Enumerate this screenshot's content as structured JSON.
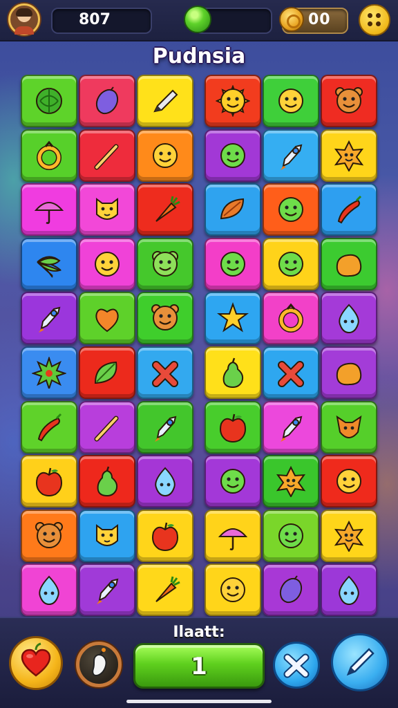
{
  "header": {
    "score": "807",
    "coins": "00"
  },
  "title": "Pudnsia",
  "footer": {
    "label": "Ilaatt:",
    "count": "1"
  },
  "board": {
    "rows": [
      [
        {
          "color": "#5ed32a",
          "icon": "melon"
        },
        {
          "color": "#ef3a5e",
          "icon": "plum"
        },
        {
          "color": "#ffe11a",
          "icon": "pencil"
        },
        {
          "color": "#f23c1e",
          "icon": "sun"
        },
        {
          "color": "#3fcf3a",
          "icon": "smiley"
        },
        {
          "color": "#ef2c22",
          "icon": "bear"
        }
      ],
      [
        {
          "color": "#57d02a",
          "icon": "ring"
        },
        {
          "color": "#ee2c3c",
          "icon": "wand"
        },
        {
          "color": "#ff8a1a",
          "icon": "smiley"
        },
        {
          "color": "#a238d6",
          "icon": "blob-face"
        },
        {
          "color": "#35aef2",
          "icon": "rocket"
        },
        {
          "color": "#ffd51a",
          "icon": "star-face"
        }
      ],
      [
        {
          "color": "#f03ce0",
          "icon": "umbrella"
        },
        {
          "color": "#f248d8",
          "icon": "cat-face"
        },
        {
          "color": "#ee2c1e",
          "icon": "carrot"
        },
        {
          "color": "#2fa3ef",
          "icon": "leaf-pod"
        },
        {
          "color": "#ff5e1a",
          "icon": "blob-face"
        },
        {
          "color": "#2e9ff0",
          "icon": "chili"
        }
      ],
      [
        {
          "color": "#2e86ef",
          "icon": "leaves"
        },
        {
          "color": "#f042d8",
          "icon": "smiley"
        },
        {
          "color": "#45c82c",
          "icon": "frog-face"
        },
        {
          "color": "#f33ec8",
          "icon": "blob-face"
        },
        {
          "color": "#ffd31a",
          "icon": "blob-face"
        },
        {
          "color": "#3ccb30",
          "icon": "blob"
        }
      ],
      [
        {
          "color": "#9b36dc",
          "icon": "rocket"
        },
        {
          "color": "#5ed12a",
          "icon": "heart"
        },
        {
          "color": "#3fce2c",
          "icon": "bear"
        },
        {
          "color": "#2ea6f1",
          "icon": "star"
        },
        {
          "color": "#f241c8",
          "icon": "ring"
        },
        {
          "color": "#a43ad8",
          "icon": "drop-face"
        }
      ],
      [
        {
          "color": "#3a8cf0",
          "icon": "spiky"
        },
        {
          "color": "#ec2a1c",
          "icon": "leaf"
        },
        {
          "color": "#33a9ef",
          "icon": "cross"
        },
        {
          "color": "#ffe01a",
          "icon": "pear"
        },
        {
          "color": "#2ea7f0",
          "icon": "cross"
        },
        {
          "color": "#a33cd8",
          "icon": "blob"
        }
      ],
      [
        {
          "color": "#5fd22a",
          "icon": "chili"
        },
        {
          "color": "#b83edc",
          "icon": "wand"
        },
        {
          "color": "#43c62c",
          "icon": "rocket"
        },
        {
          "color": "#48cd2c",
          "icon": "apple"
        },
        {
          "color": "#ec48dc",
          "icon": "rocket"
        },
        {
          "color": "#55cf2a",
          "icon": "fox"
        }
      ],
      [
        {
          "color": "#ffd01a",
          "icon": "apple"
        },
        {
          "color": "#ee281c",
          "icon": "pear"
        },
        {
          "color": "#a536d6",
          "icon": "drop-face"
        },
        {
          "color": "#a338d8",
          "icon": "blob-face"
        },
        {
          "color": "#3ac62c",
          "icon": "star-face"
        },
        {
          "color": "#ef2a1c",
          "icon": "smiley"
        }
      ],
      [
        {
          "color": "#ff7a1a",
          "icon": "bear"
        },
        {
          "color": "#2ea3f0",
          "icon": "cat-face"
        },
        {
          "color": "#ffd51a",
          "icon": "apple"
        },
        {
          "color": "#ffd31a",
          "icon": "umbrella"
        },
        {
          "color": "#7ad62a",
          "icon": "blob-face"
        },
        {
          "color": "#ffd51a",
          "icon": "star-face"
        }
      ],
      [
        {
          "color": "#f044d4",
          "icon": "drop-face"
        },
        {
          "color": "#a03ad8",
          "icon": "rocket"
        },
        {
          "color": "#ffd81a",
          "icon": "carrot"
        },
        {
          "color": "#ffd51a",
          "icon": "smiley"
        },
        {
          "color": "#a838d6",
          "icon": "plum"
        },
        {
          "color": "#9c38d8",
          "icon": "drop-face"
        }
      ]
    ]
  },
  "colors": {
    "accent_green": "#5ed22a",
    "accent_gold": "#f0b81a",
    "accent_blue": "#2ea8ef"
  }
}
